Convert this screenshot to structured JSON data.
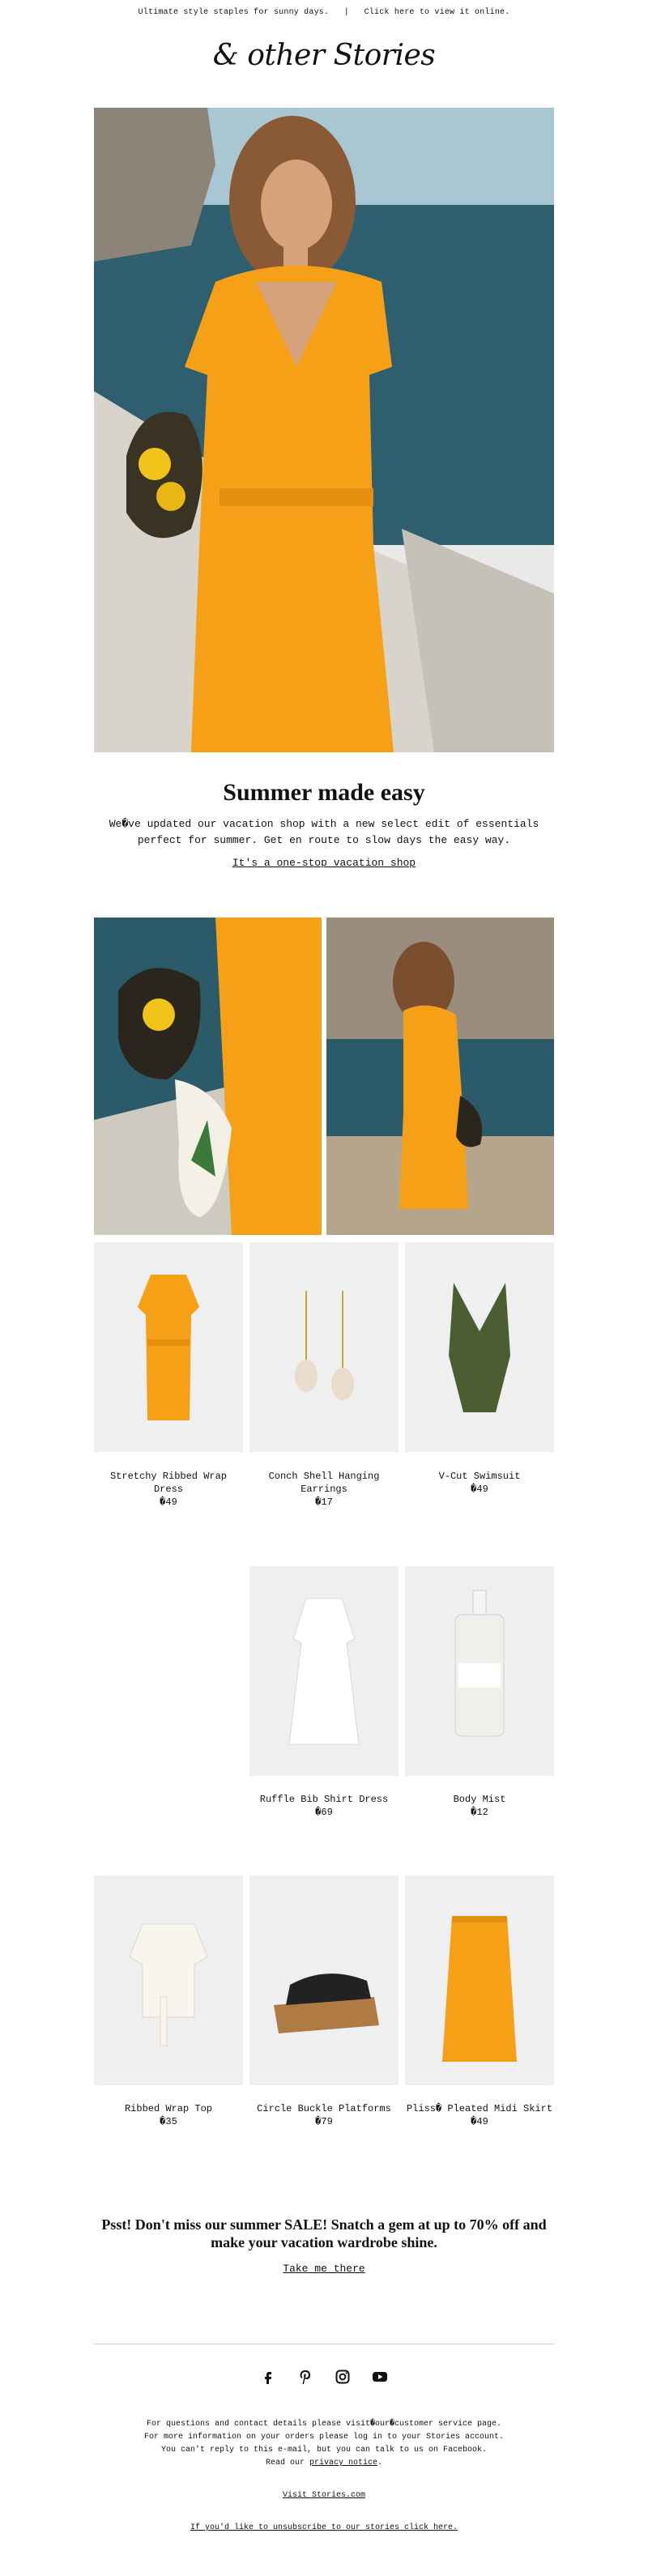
{
  "preheader": {
    "tagline": "Ultimate style staples for sunny days.",
    "separator": "|",
    "view_online": "Click here to view it online."
  },
  "brand": {
    "logo_text": "& other Stories"
  },
  "hero": {
    "headline": "Summer made easy",
    "body": "We�ve updated our vacation shop with a new select edit of essentials perfect for summer. Get en route to slow days the easy way.",
    "cta": "It's a one-stop vacation shop"
  },
  "products_row1": [
    {
      "name": "Stretchy Ribbed Wrap Dress",
      "price": "�49"
    },
    {
      "name": "Conch Shell Hanging Earrings",
      "price": "�17"
    },
    {
      "name": "V-Cut Swimsuit",
      "price": "�49"
    }
  ],
  "products_row2": [
    {
      "name": "Ruffle Bib Shirt Dress",
      "price": "�69"
    },
    {
      "name": "Body Mist",
      "price": "�12"
    }
  ],
  "products_row3": [
    {
      "name": "Ribbed Wrap Top",
      "price": "�35"
    },
    {
      "name": "Circle Buckle Platforms",
      "price": "�79"
    },
    {
      "name": "Pliss� Pleated Midi Skirt",
      "price": "�49"
    }
  ],
  "sale": {
    "text": "Psst! Don't miss our summer SALE! Snatch a gem at up to 70% off and make your vacation wardrobe shine.",
    "cta": "Take me there"
  },
  "social": [
    "facebook-icon",
    "pinterest-icon",
    "instagram-icon",
    "youtube-icon"
  ],
  "footer": {
    "line1": "For questions and contact details please visit�our�customer service page.",
    "line2": "For more information on your orders please log in to your Stories account.",
    "line3": "You can't reply to this e-mail, but you can talk to us on Facebook.",
    "line4_prefix": "Read our",
    "privacy_link": "privacy notice",
    "line4_suffix": ".",
    "visit_link": "Visit Stories.com",
    "unsubscribe_link": "If you'd like to unsubscribe to our stories click here."
  },
  "colors": {
    "accent_orange": "#f6a018",
    "sea": "#2f5f6e",
    "swimsuit_green": "#4b5e31"
  }
}
